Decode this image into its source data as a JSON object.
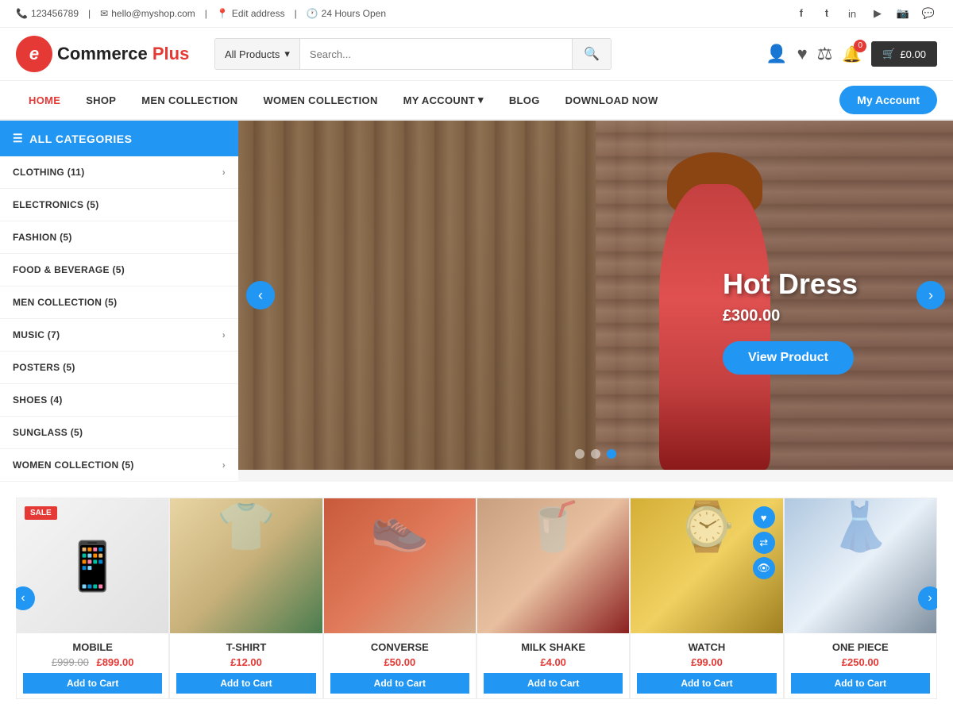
{
  "topbar": {
    "phone": "123456789",
    "email": "hello@myshop.com",
    "address_link": "Edit address",
    "hours": "24 Hours Open",
    "socials": [
      "facebook",
      "twitter",
      "linkedin",
      "youtube",
      "instagram",
      "whatsapp"
    ]
  },
  "header": {
    "logo_letter": "e",
    "logo_text": "Commerce",
    "logo_plus": "Plus",
    "search_category": "All Products",
    "search_placeholder": "Search...",
    "cart_label": "£0.00",
    "cart_count": "0"
  },
  "nav": {
    "items": [
      {
        "label": "HOME",
        "active": true
      },
      {
        "label": "SHOP",
        "active": false
      },
      {
        "label": "MEN COLLECTION",
        "active": false
      },
      {
        "label": "WOMEN COLLECTION",
        "active": false
      },
      {
        "label": "MY ACCOUNT",
        "active": false,
        "has_dropdown": true
      },
      {
        "label": "BLOG",
        "active": false
      },
      {
        "label": "DOWNLOAD NOW",
        "active": false
      }
    ],
    "cta_label": "My Account"
  },
  "sidebar": {
    "header": "ALL CATEGORIES",
    "items": [
      {
        "label": "CLOTHING (11)",
        "has_arrow": true
      },
      {
        "label": "ELECTRONICS (5)",
        "has_arrow": false
      },
      {
        "label": "FASHION (5)",
        "has_arrow": false
      },
      {
        "label": "FOOD & BEVERAGE (5)",
        "has_arrow": false
      },
      {
        "label": "MEN COLLECTION (5)",
        "has_arrow": false
      },
      {
        "label": "MUSIC (7)",
        "has_arrow": true
      },
      {
        "label": "POSTERS (5)",
        "has_arrow": false
      },
      {
        "label": "SHOES (4)",
        "has_arrow": false
      },
      {
        "label": "SUNGLASS (5)",
        "has_arrow": false
      },
      {
        "label": "WOMEN COLLECTION (5)",
        "has_arrow": true
      }
    ]
  },
  "hero": {
    "title": "Hot Dress",
    "price": "£300.00",
    "btn_label": "View Product",
    "dots": [
      false,
      false,
      true
    ]
  },
  "products": {
    "prev_label": "‹",
    "next_label": "›",
    "items": [
      {
        "name": "MOBILE",
        "price": "£899.00",
        "old_price": "£999.00",
        "has_sale": true,
        "icon": "📱",
        "img_class": "mobile",
        "btn_label": "Add to Cart"
      },
      {
        "name": "T-SHIRT",
        "price": "£12.00",
        "old_price": "",
        "has_sale": false,
        "icon": "👕",
        "img_class": "tshirt",
        "btn_label": "Add to Cart"
      },
      {
        "name": "CONVERSE",
        "price": "£50.00",
        "old_price": "",
        "has_sale": false,
        "icon": "👟",
        "img_class": "converse",
        "btn_label": "Add to Cart"
      },
      {
        "name": "MILK SHAKE",
        "price": "£4.00",
        "old_price": "",
        "has_sale": false,
        "icon": "🥤",
        "img_class": "milkshake",
        "btn_label": "Add to Cart"
      },
      {
        "name": "WATCH",
        "price": "£99.00",
        "old_price": "",
        "has_sale": false,
        "icon": "⌚",
        "img_class": "watch",
        "btn_label": "Add to Cart",
        "has_actions": true
      },
      {
        "name": "ONE PIECE",
        "price": "£250.00",
        "old_price": "",
        "has_sale": false,
        "icon": "👗",
        "img_class": "onepiece",
        "btn_label": "Add to Cart"
      }
    ]
  }
}
